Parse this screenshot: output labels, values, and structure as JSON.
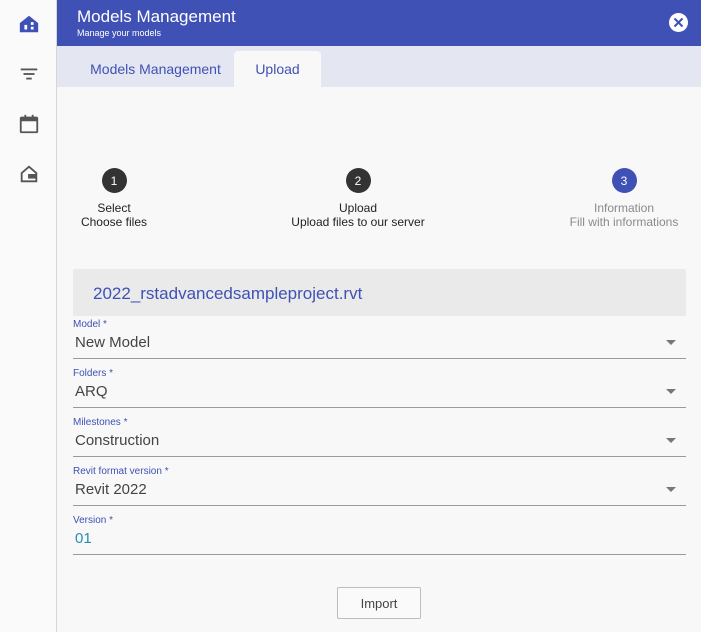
{
  "header": {
    "title": "Models Management",
    "subtitle": "Manage your models"
  },
  "tabs": [
    {
      "label": "Models Management",
      "active": false
    },
    {
      "label": "Upload",
      "active": true
    }
  ],
  "steps": [
    {
      "number": "1",
      "label": "Select",
      "desc": "Choose files",
      "state": "done"
    },
    {
      "number": "2",
      "label": "Upload",
      "desc": "Upload files to our server",
      "state": "done"
    },
    {
      "number": "3",
      "label": "Information",
      "desc": "Fill with informations",
      "state": "current"
    }
  ],
  "file": {
    "name": "2022_rstadvancedsampleproject.rvt"
  },
  "form": {
    "model": {
      "label": "Model *",
      "value": "New Model"
    },
    "folders": {
      "label": "Folders *",
      "value": "ARQ"
    },
    "milestones": {
      "label": "Milestones *",
      "value": "Construction"
    },
    "revit": {
      "label": "Revit format version *",
      "value": "Revit 2022"
    },
    "version": {
      "label": "Version  *",
      "value": "01"
    }
  },
  "actions": {
    "import_label": "Import"
  },
  "colors": {
    "primary": "#3f51b5",
    "step_done": "#333333",
    "tab_bar": "#e4e7f2"
  },
  "icons": [
    "home-icon",
    "filter-icon",
    "calendar-icon",
    "house-exit-icon",
    "close-icon"
  ]
}
